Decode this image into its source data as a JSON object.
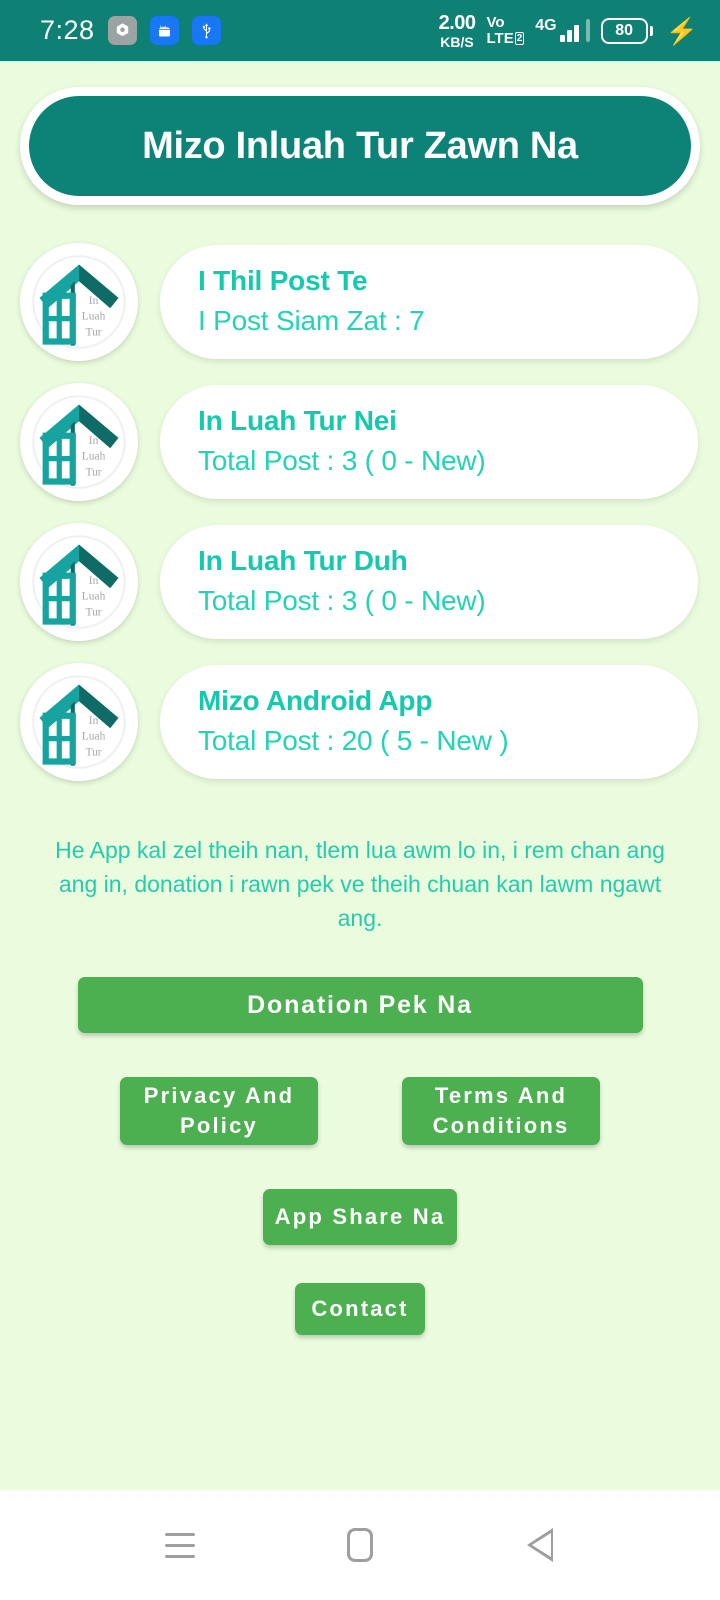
{
  "status_bar": {
    "clock": "7:28",
    "icons": [
      "settings-chip-icon",
      "android-chip-icon",
      "usb-chip-icon"
    ],
    "net_speed_value": "2.00",
    "net_speed_unit": "KB/S",
    "volte_line1": "Vo",
    "volte_line2": "LTE",
    "sim_number": "2",
    "network_type": "4G",
    "battery_percent": "80",
    "charging": true,
    "background_color": "#0E8074"
  },
  "header": {
    "title": "Mizo Inluah Tur Zawn Na",
    "background_color": "#0D8377",
    "text_color": "#FFFFFF"
  },
  "logo": {
    "text_line1": "In",
    "text_line2": "Luah",
    "text_line3": "Tur",
    "roof_color": "#0E6B66",
    "body_color": "#17A3A0"
  },
  "list": {
    "items": [
      {
        "title": "I Thil Post Te",
        "subtitle": "I Post Siam Zat : 7"
      },
      {
        "title": "In Luah Tur Nei",
        "subtitle": "Total Post : 3 ( 0 - New)"
      },
      {
        "title": "In Luah Tur Duh",
        "subtitle": "Total Post : 3 ( 0 - New)"
      },
      {
        "title": "Mizo Android App",
        "subtitle": "Total Post : 20 ( 5 - New )"
      }
    ],
    "title_color": "#14C9AE",
    "subtitle_color": "#24D3B4"
  },
  "note": {
    "text": "He App kal zel theih nan, tlem lua awm lo in, i rem chan ang ang in, donation i rawn pek ve theih chuan kan lawm ngawt ang.",
    "color": "#26CBAE"
  },
  "buttons": {
    "donation": "Donation Pek Na",
    "privacy": "Privacy And Policy",
    "terms": "Terms And Conditions",
    "share": "App Share Na",
    "contact": "Contact",
    "color": "#4CAF50",
    "text_color": "#FFFFFF"
  },
  "nav_bar": {
    "recents_label": "recents-icon",
    "home_label": "home-icon",
    "back_label": "back-icon"
  },
  "page": {
    "background_color": "#EBFCDE"
  }
}
